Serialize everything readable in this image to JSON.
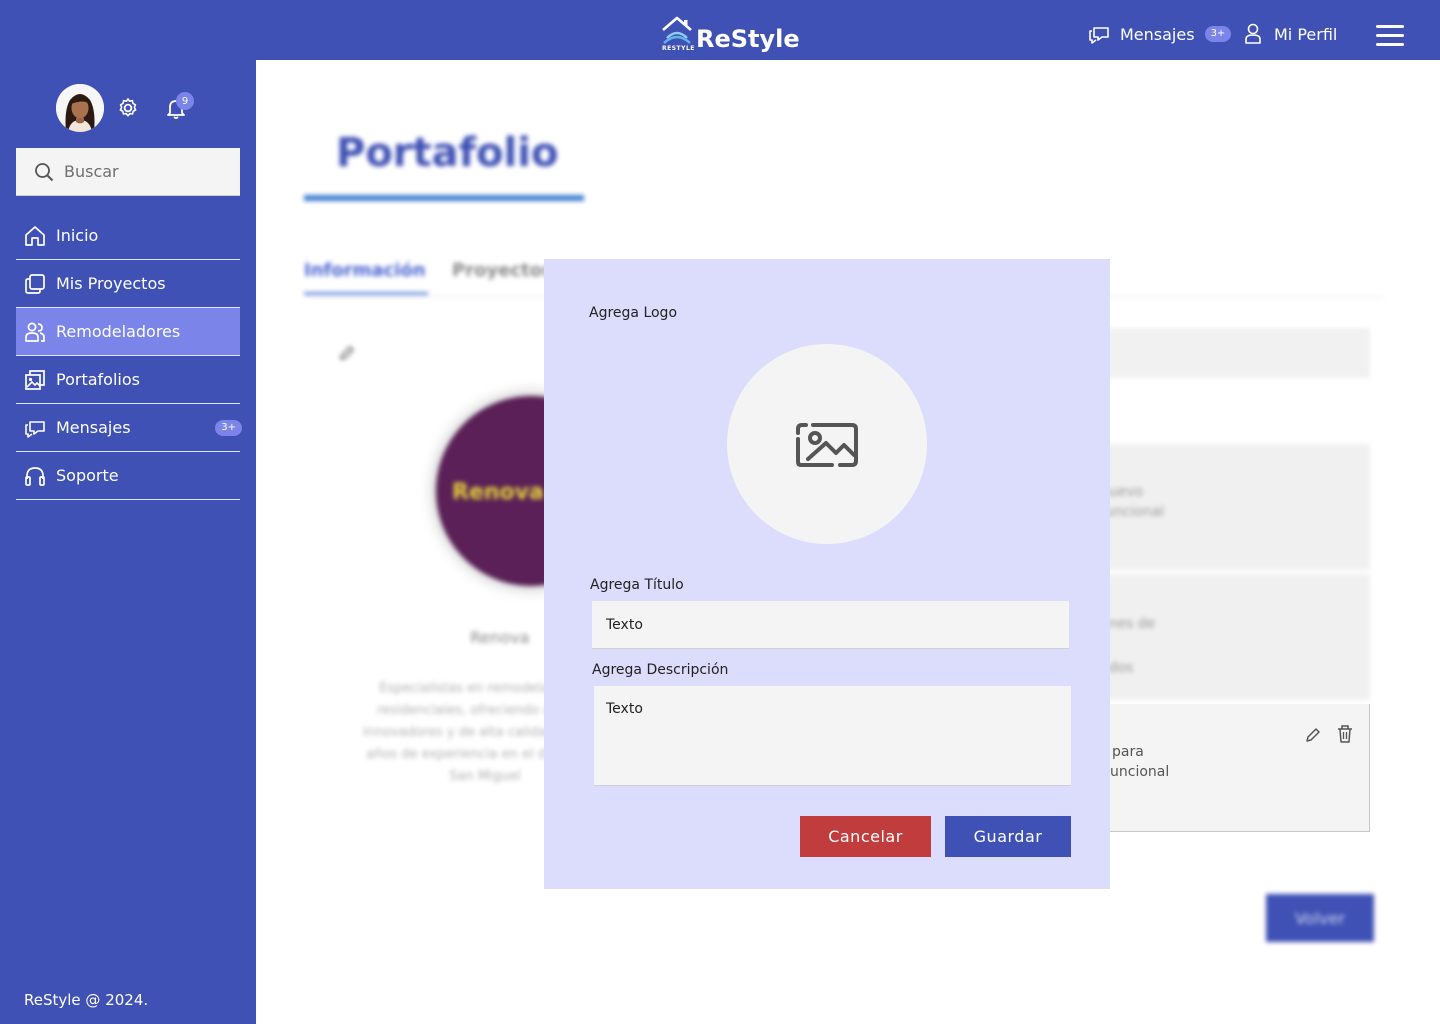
{
  "topbar": {
    "brand": "ReStyle",
    "brand_sub": "RESTYLE",
    "messages_label": "Mensajes",
    "messages_badge": "3+",
    "profile_label": "Mi Perfil"
  },
  "sidebar": {
    "notifications_count": "9",
    "search_placeholder": "Buscar",
    "items": [
      {
        "label": "Inicio"
      },
      {
        "label": "Mis Proyectos"
      },
      {
        "label": "Remodeladores"
      },
      {
        "label": "Portafolios"
      },
      {
        "label": "Mensajes",
        "badge": "3+"
      },
      {
        "label": "Soporte"
      }
    ],
    "active_item": "Remodeladores",
    "footer": "ReStyle @ 2024."
  },
  "background": {
    "title": "Portafolio",
    "tabs": [
      "Información",
      "Proyectos"
    ],
    "logo_text": "Renova",
    "name": "Renova",
    "description": "Especialistas en remodelaciones residenciales, ofreciendo diseños innovadores y de alta calidad, con 10 años de experiencia en el distrito de San Miguel",
    "card1_lines": [
      "nuevo",
      "funcional"
    ],
    "card2_lines": [
      "ones de",
      "ados"
    ],
    "card3_lines": [
      "para",
      "uncional"
    ],
    "back_button": "Volver"
  },
  "modal": {
    "logo_label": "Agrega Logo",
    "title_label": "Agrega Título",
    "title_value": "Texto",
    "description_label": "Agrega Descripción",
    "description_value": "Texto",
    "cancel_label": "Cancelar",
    "save_label": "Guardar"
  },
  "colors": {
    "primary": "#3f51b5",
    "active_nav": "#7b84e8",
    "modal_bg": "#dcdcfc",
    "cancel": "#c13c3c"
  }
}
